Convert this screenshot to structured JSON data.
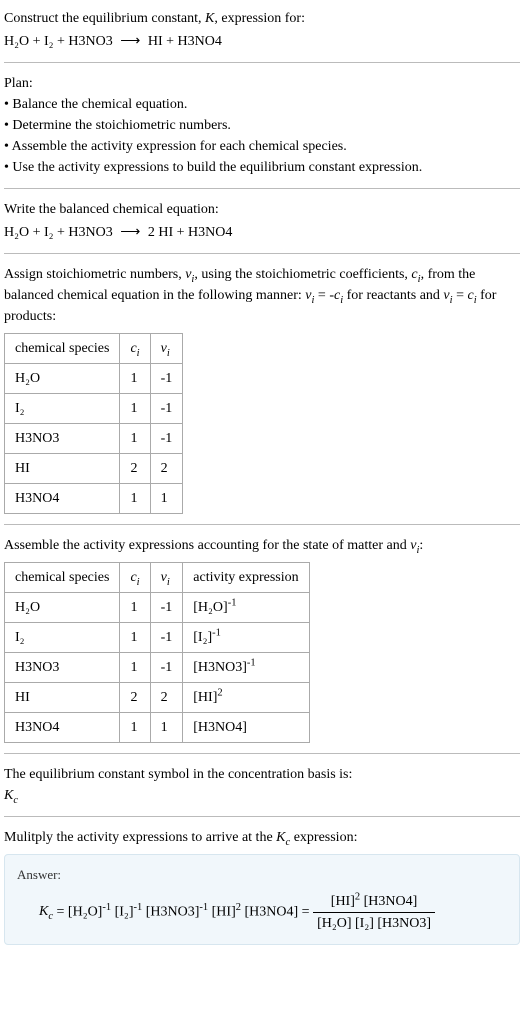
{
  "prompt": {
    "line1": "Construct the equilibrium constant, K, expression for:",
    "equation_lhs": "H₂O + I₂ + H3NO3",
    "equation_arrow": "⟶",
    "equation_rhs": "HI + H3NO4"
  },
  "plan": {
    "title": "Plan:",
    "items": [
      "• Balance the chemical equation.",
      "• Determine the stoichiometric numbers.",
      "• Assemble the activity expression for each chemical species.",
      "• Use the activity expressions to build the equilibrium constant expression."
    ]
  },
  "balanced": {
    "title": "Write the balanced chemical equation:",
    "lhs": "H₂O + I₂ + H3NO3",
    "arrow": "⟶",
    "rhs": "2 HI + H3NO4"
  },
  "stoich": {
    "intro": "Assign stoichiometric numbers, νᵢ, using the stoichiometric coefficients, cᵢ, from the balanced chemical equation in the following manner: νᵢ = -cᵢ for reactants and νᵢ = cᵢ for products:",
    "headers": {
      "c0": "chemical species",
      "c1": "cᵢ",
      "c2": "νᵢ"
    },
    "rows": [
      {
        "species": "H₂O",
        "c": "1",
        "v": "-1"
      },
      {
        "species": "I₂",
        "c": "1",
        "v": "-1"
      },
      {
        "species": "H3NO3",
        "c": "1",
        "v": "-1"
      },
      {
        "species": "HI",
        "c": "2",
        "v": "2"
      },
      {
        "species": "H3NO4",
        "c": "1",
        "v": "1"
      }
    ]
  },
  "activity": {
    "intro": "Assemble the activity expressions accounting for the state of matter and νᵢ:",
    "headers": {
      "c0": "chemical species",
      "c1": "cᵢ",
      "c2": "νᵢ",
      "c3": "activity expression"
    },
    "rows": [
      {
        "species": "H₂O",
        "c": "1",
        "v": "-1",
        "expr_base": "[H₂O]",
        "expr_pow": "-1"
      },
      {
        "species": "I₂",
        "c": "1",
        "v": "-1",
        "expr_base": "[I₂]",
        "expr_pow": "-1"
      },
      {
        "species": "H3NO3",
        "c": "1",
        "v": "-1",
        "expr_base": "[H3NO3]",
        "expr_pow": "-1"
      },
      {
        "species": "HI",
        "c": "2",
        "v": "2",
        "expr_base": "[HI]",
        "expr_pow": "2"
      },
      {
        "species": "H3NO4",
        "c": "1",
        "v": "1",
        "expr_base": "[H3NO4]",
        "expr_pow": ""
      }
    ]
  },
  "kc_symbol": {
    "line1": "The equilibrium constant symbol in the concentration basis is:",
    "line2": "K_c"
  },
  "multiply_line": "Mulitply the activity expressions to arrive at the K_c expression:",
  "answer": {
    "label": "Answer:",
    "lhs": "K_c = ",
    "t1_base": "[H₂O]",
    "t1_pow": "-1",
    "t2_base": "[I₂]",
    "t2_pow": "-1",
    "t3_base": "[H3NO3]",
    "t3_pow": "-1",
    "t4_base": "[HI]",
    "t4_pow": "2",
    "t5_base": "[H3NO4]",
    "eq": " = ",
    "num_b1": "[HI]",
    "num_p1": "2",
    "num_b2": "[H3NO4]",
    "den_b1": "[H₂O]",
    "den_b2": "[I₂]",
    "den_b3": "[H3NO3]"
  }
}
